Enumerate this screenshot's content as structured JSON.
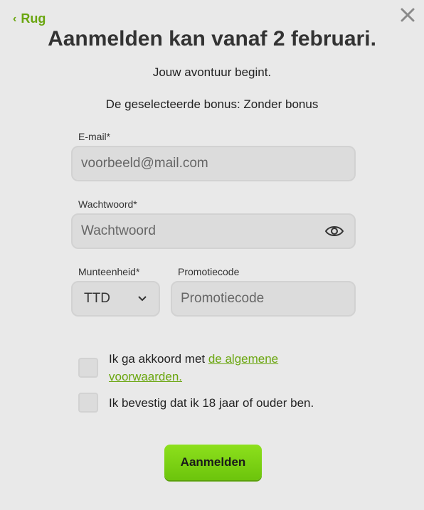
{
  "nav": {
    "back_label": "Rug",
    "close_icon": "close-icon"
  },
  "header": {
    "title": "Aanmelden kan vanaf 2 februari.",
    "subtitle": "Jouw avontuur begint.",
    "bonus_text": "De geselecteerde bonus: Zonder bonus"
  },
  "form": {
    "email": {
      "label": "E-mail*",
      "placeholder": "voorbeeld@mail.com",
      "value": ""
    },
    "password": {
      "label": "Wachtwoord*",
      "placeholder": "Wachtwoord",
      "value": "",
      "icon": "eye-icon"
    },
    "currency": {
      "label": "Munteenheid*",
      "selected": "TTD"
    },
    "promo": {
      "label": "Promotiecode",
      "placeholder": "Promotiecode",
      "value": ""
    },
    "terms": {
      "prefix": "Ik ga akkoord met ",
      "link": "de algemene voorwaarden.",
      "checked": false
    },
    "age": {
      "label": "Ik bevestig dat ik 18 jaar of ouder ben.",
      "checked": false
    },
    "submit_label": "Aanmelden"
  },
  "colors": {
    "accent": "#6aa60f",
    "button": "#7ad314",
    "background": "#e9e9e9",
    "field": "#dcdcdc"
  }
}
